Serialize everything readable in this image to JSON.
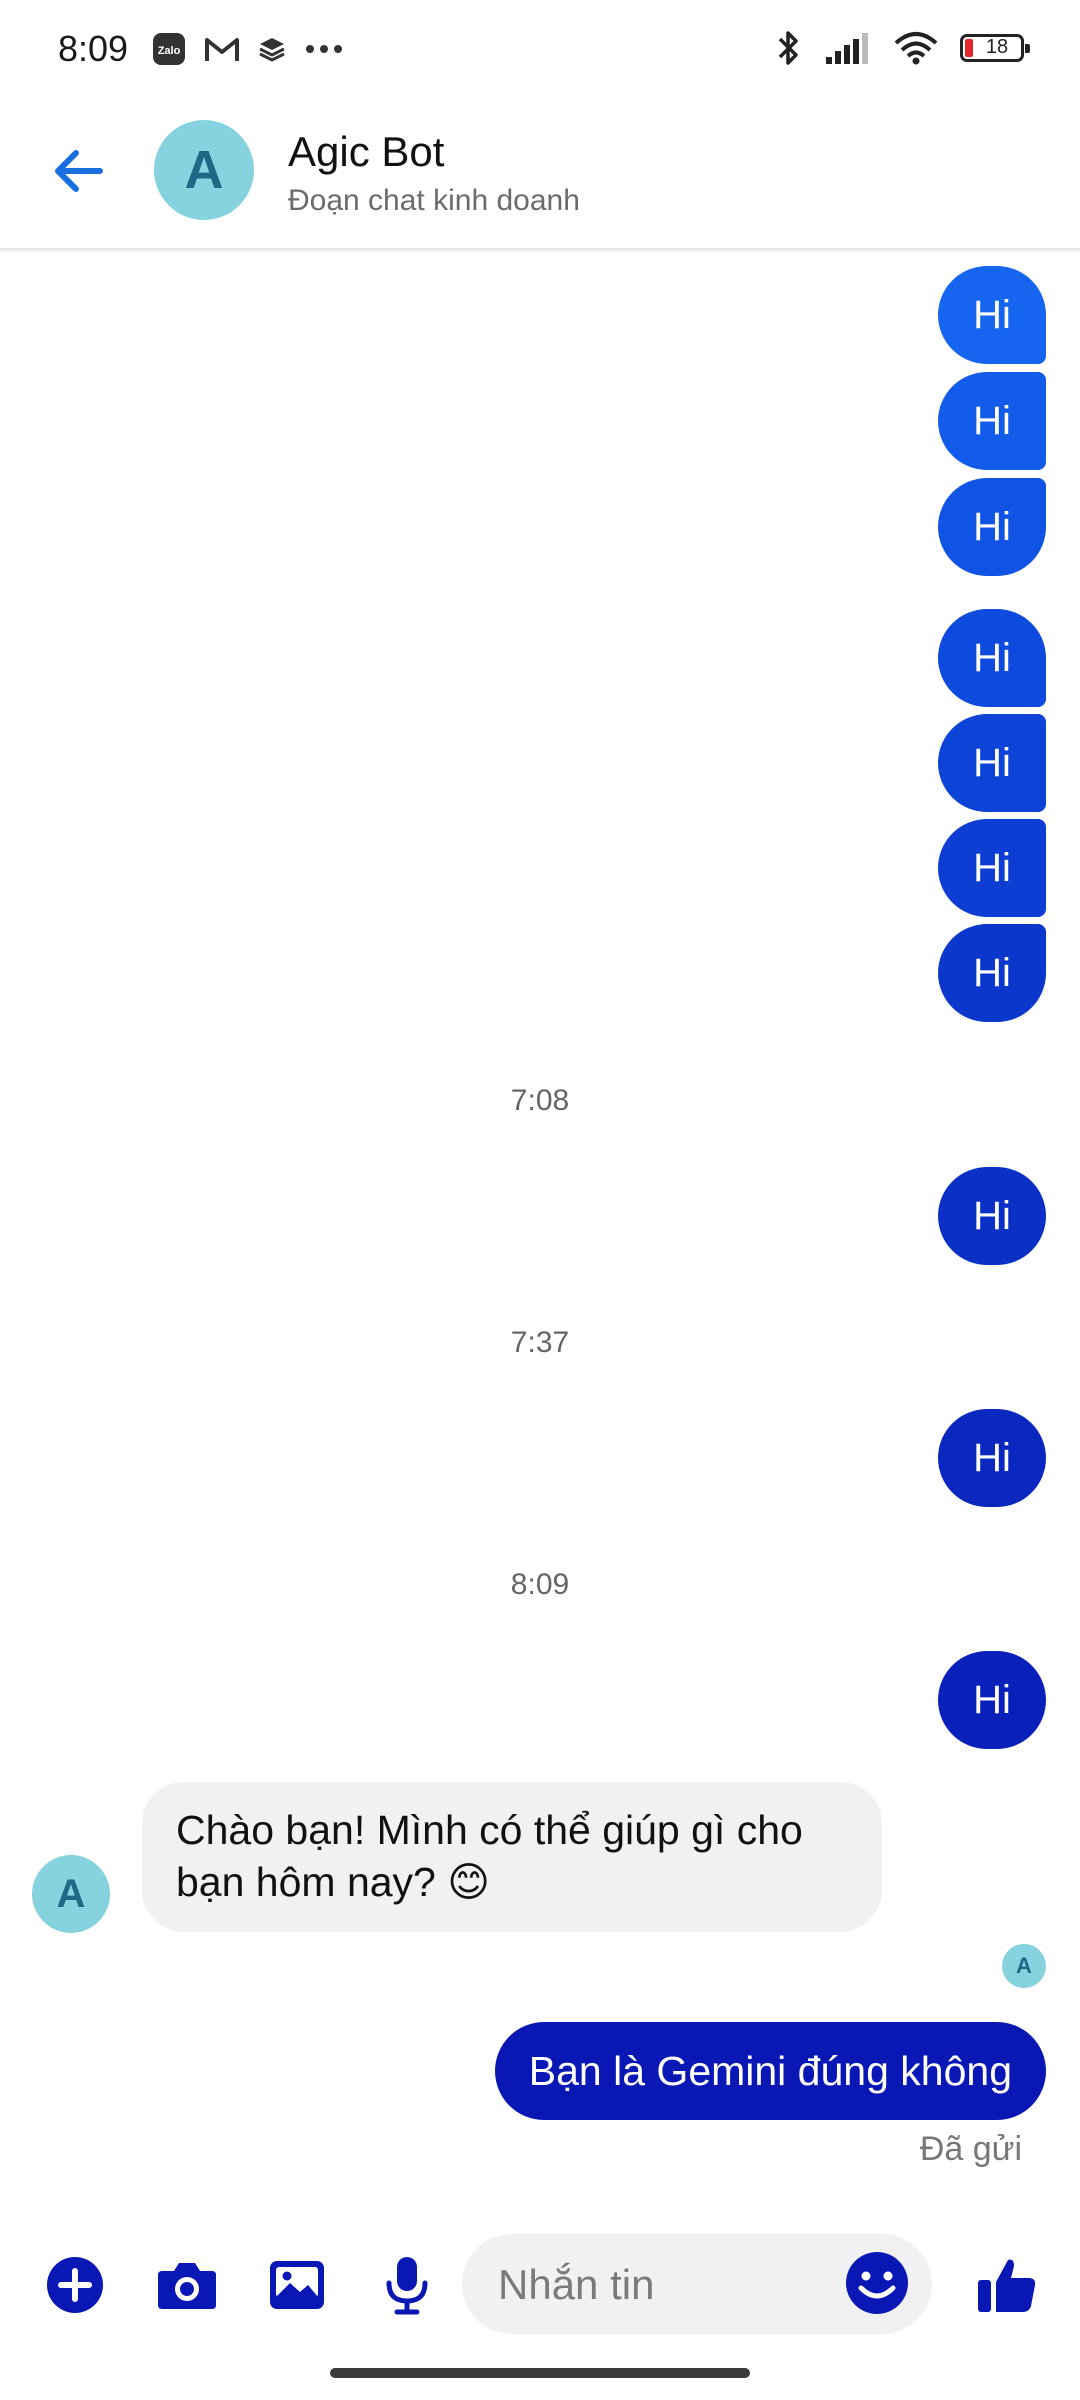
{
  "status_bar": {
    "time": "8:09",
    "battery": "18"
  },
  "header": {
    "avatar_letter": "A",
    "title": "Agic Bot",
    "subtitle": "Đoạn chat kinh doanh"
  },
  "messages": {
    "hi_text": "Hi",
    "ts1": "7:08",
    "ts2": "7:37",
    "ts3": "8:09",
    "bot_avatar_letter": "A",
    "bot_reply": "Chào bạn! Mình có thể giúp gì cho bạn hôm nay? 😊",
    "seen_letter": "A",
    "user_message": "Bạn là Gemini đúng không",
    "sent_status": "Đã gửi"
  },
  "composer": {
    "placeholder": "Nhắn tin"
  },
  "colors": {
    "accent": "#0917b5",
    "bubble_start": "#1565f0",
    "bubble_end": "#0917b5",
    "avatar": "#86d3df",
    "back": "#1a6fe0"
  },
  "icons": [
    "zalo-icon",
    "gmail-icon",
    "layers-icon",
    "more-icon",
    "bluetooth-icon",
    "signal-icon",
    "wifi-icon",
    "battery-icon",
    "back-arrow-icon",
    "plus-icon",
    "camera-icon",
    "image-icon",
    "mic-icon",
    "emoji-icon",
    "thumbs-up-icon"
  ]
}
